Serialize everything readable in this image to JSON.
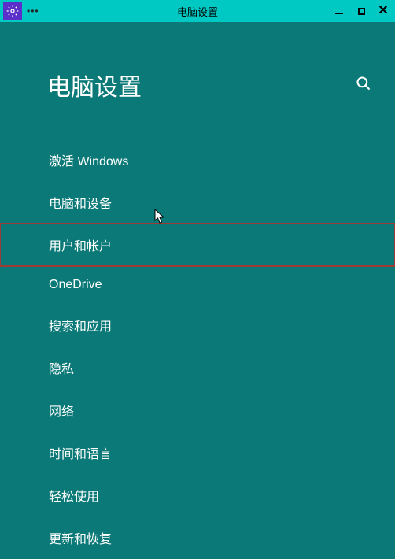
{
  "titlebar": {
    "title": "电脑设置",
    "dots": "•••"
  },
  "page": {
    "title": "电脑设置"
  },
  "menu": {
    "items": [
      {
        "label": "激活 Windows"
      },
      {
        "label": "电脑和设备"
      },
      {
        "label": "用户和帐户"
      },
      {
        "label": "OneDrive"
      },
      {
        "label": "搜索和应用"
      },
      {
        "label": "隐私"
      },
      {
        "label": "网络"
      },
      {
        "label": "时间和语言"
      },
      {
        "label": "轻松使用"
      },
      {
        "label": "更新和恢复"
      }
    ],
    "highlighted_index": 2
  }
}
